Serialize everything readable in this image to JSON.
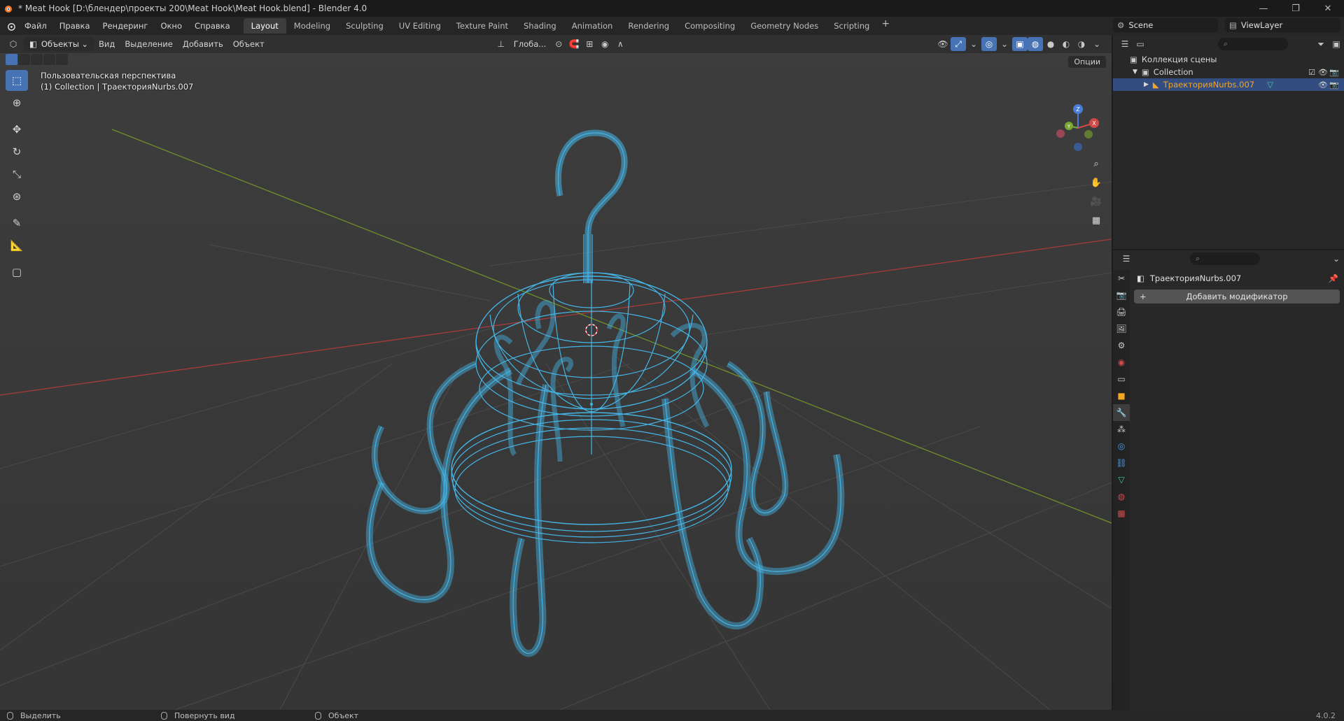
{
  "window": {
    "title": "* Meat Hook [D:\\блендер\\проекты 200\\Meat Hook\\Meat Hook.blend] - Blender 4.0",
    "controls": [
      "—",
      "❐",
      "✕"
    ]
  },
  "menu": {
    "items": [
      "Файл",
      "Правка",
      "Рендеринг",
      "Окно",
      "Справка"
    ]
  },
  "workspaces": {
    "active": "Layout",
    "tabs": [
      "Layout",
      "Modeling",
      "Sculpting",
      "UV Editing",
      "Texture Paint",
      "Shading",
      "Animation",
      "Rendering",
      "Compositing",
      "Geometry Nodes",
      "Scripting"
    ],
    "add": "+"
  },
  "scene": {
    "name": "Scene",
    "view_layer": "ViewLayer"
  },
  "viewport": {
    "mode": "Объекты",
    "menus": [
      "Вид",
      "Выделение",
      "Добавить",
      "Объект"
    ],
    "transform_orientation": "Глоба...",
    "options_label": "Опции",
    "info_line1": "Пользовательская перспектива",
    "info_line2": "(1) Collection | ТраекторияNurbs.007",
    "gizmo": {
      "x": "X",
      "y": "Y",
      "z": "Z"
    },
    "wire_color": "#45b5e6"
  },
  "outliner": {
    "root": "Коллекция сцены",
    "collection": "Collection",
    "object": "ТраекторияNurbs.007"
  },
  "properties": {
    "object_name": "ТраекторияNurbs.007",
    "add_modifier": "Добавить модификатор"
  },
  "statusbar": {
    "items": [
      "Выделить",
      "Повернуть вид",
      "Объект"
    ],
    "version": "4.0.2"
  },
  "colors": {
    "accent": "#4772b3",
    "selection_highlight": "#334d80",
    "object_orange": "#f5a623",
    "grid_red_axis": "#b03a3a",
    "grid_green_axis": "#7a9a2a"
  }
}
